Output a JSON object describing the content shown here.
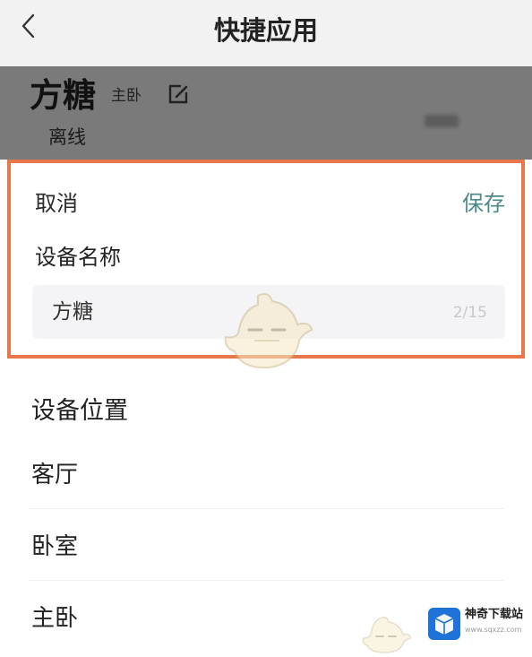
{
  "header": {
    "title": "快捷应用",
    "back_icon": "chevron-left-icon"
  },
  "device": {
    "name": "方糖",
    "room": "主卧",
    "status": "离线",
    "edit_icon": "edit-icon"
  },
  "rename_sheet": {
    "cancel_label": "取消",
    "save_label": "保存",
    "field_label": "设备名称",
    "input_value": "方糖",
    "char_count": "2/15",
    "accent_color": "#4a8a88",
    "highlight_color": "#e8784a"
  },
  "location": {
    "title": "设备位置",
    "options": [
      {
        "label": "客厅"
      },
      {
        "label": "卧室"
      },
      {
        "label": "主卧"
      }
    ]
  },
  "watermark": {
    "name": "神奇下载站",
    "url": "www.sqxzz.com"
  }
}
